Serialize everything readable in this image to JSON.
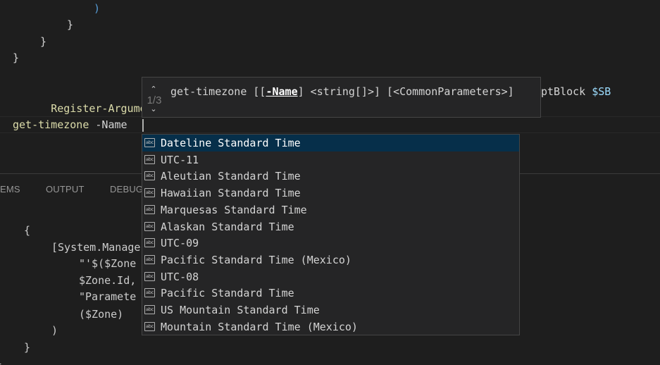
{
  "editor": {
    "lines": [
      {
        "text": ")"
      },
      {
        "text": "}"
      },
      {
        "text": "}"
      },
      {
        "text": "}"
      },
      {
        "cmd": "Register-ArgumentCo",
        "tail": "ptBlock ",
        "var": "$SB"
      },
      {
        "cmd": "get-timezone",
        "param": " -Name "
      }
    ]
  },
  "signature_help": {
    "up_icon": "chevron-up-icon",
    "down_icon": "chevron-down-icon",
    "counter": "1/3",
    "prefix": "get-timezone [[",
    "active_param": "-Name",
    "suffix": "] <string[]>] [<CommonParameters>]"
  },
  "suggestions": {
    "icon_text": "abc",
    "icon_name": "text-value-icon",
    "items": [
      {
        "label": "Dateline Standard Time",
        "selected": true
      },
      {
        "label": "UTC-11"
      },
      {
        "label": "Aleutian Standard Time"
      },
      {
        "label": "Hawaiian Standard Time"
      },
      {
        "label": "Marquesas Standard Time"
      },
      {
        "label": "Alaskan Standard Time"
      },
      {
        "label": "UTC-09"
      },
      {
        "label": "Pacific Standard Time (Mexico)"
      },
      {
        "label": "UTC-08"
      },
      {
        "label": "Pacific Standard Time"
      },
      {
        "label": "US Mountain Standard Time"
      },
      {
        "label": "Mountain Standard Time (Mexico)"
      }
    ]
  },
  "panel": {
    "tabs": [
      "EMS",
      "OUTPUT",
      "DEBUG"
    ],
    "lines": [
      "{",
      "[System.Manage",
      "\"'$($Zone",
      "$Zone.Id,",
      "\"Paramete",
      "($Zone)",
      ")",
      "}",
      "}"
    ]
  }
}
